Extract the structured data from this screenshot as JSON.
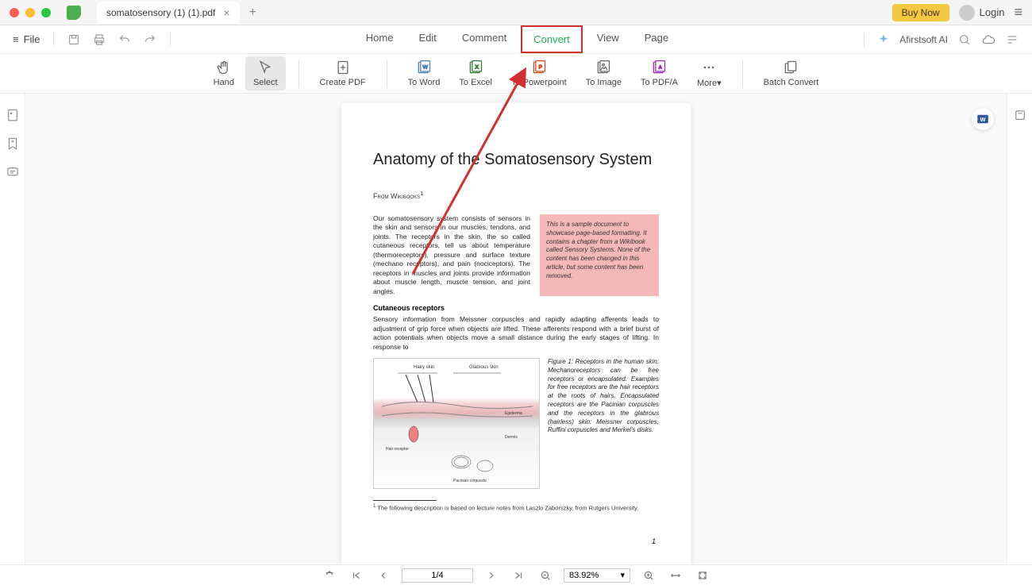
{
  "titlebar": {
    "tab_name": "somatosensory (1) (1).pdf",
    "buy_label": "Buy Now",
    "login_label": "Login"
  },
  "menubar": {
    "file_label": "File",
    "tabs": [
      "Home",
      "Edit",
      "Comment",
      "Convert",
      "View",
      "Page"
    ],
    "active_tab": "Convert",
    "ai_label": "Afirstsoft AI"
  },
  "ribbon": {
    "hand": "Hand",
    "select": "Select",
    "create_pdf": "Create PDF",
    "to_word": "To Word",
    "to_excel": "To Excel",
    "to_powerpoint": "To Powerpoint",
    "to_image": "To Image",
    "to_pdfa": "To PDF/A",
    "more": "More",
    "batch": "Batch Convert"
  },
  "document": {
    "title": "Anatomy of the Somatosensory System",
    "source": "From Wikibooks",
    "source_sup": "1",
    "para1": "Our somatosensory system consists of sensors in the skin and sensors in our muscles, tendons, and joints. The receptors in the skin, the so called cutaneous receptors, tell us about temperature (thermoreceptors), pressure and surface texture (mechano receptors), and pain (nociceptors). The receptors in muscles and joints provide information about muscle length, muscle tension, and joint angles.",
    "callout": "This is a sample document to showcase page-based formatting. It contains a chapter from a Wikibook called Sensory Systems. None of the content has been changed in this article, but some content has been removed.",
    "subhead": "Cutaneous receptors",
    "para2": "Sensory information from Meissner corpuscles and rapidly adapting afferents leads to adjustment of grip force when objects are lifted. These afferents respond with a brief burst of action potentials when objects move a small distance during the early stages of lifting. In response to",
    "fig_caption": "Figure 1:  Receptors in the human skin: Mechanoreceptors can be free receptors or encapsulated. Examples for free receptors are the hair receptors at the roots of hairs. Encapsulated receptors are the Pacinian corpuscles and the receptors in the glabrous (hairless) skin: Meissner corpuscles, Ruffini corpuscles and Merkel's disks.",
    "footnote": " The following description is based on lecture notes from Laszlo Zaborszky, from Rutgers University.",
    "footnote_sup": "1",
    "page_number": "1"
  },
  "bottombar": {
    "page": "1/4",
    "zoom": "83.92%"
  }
}
